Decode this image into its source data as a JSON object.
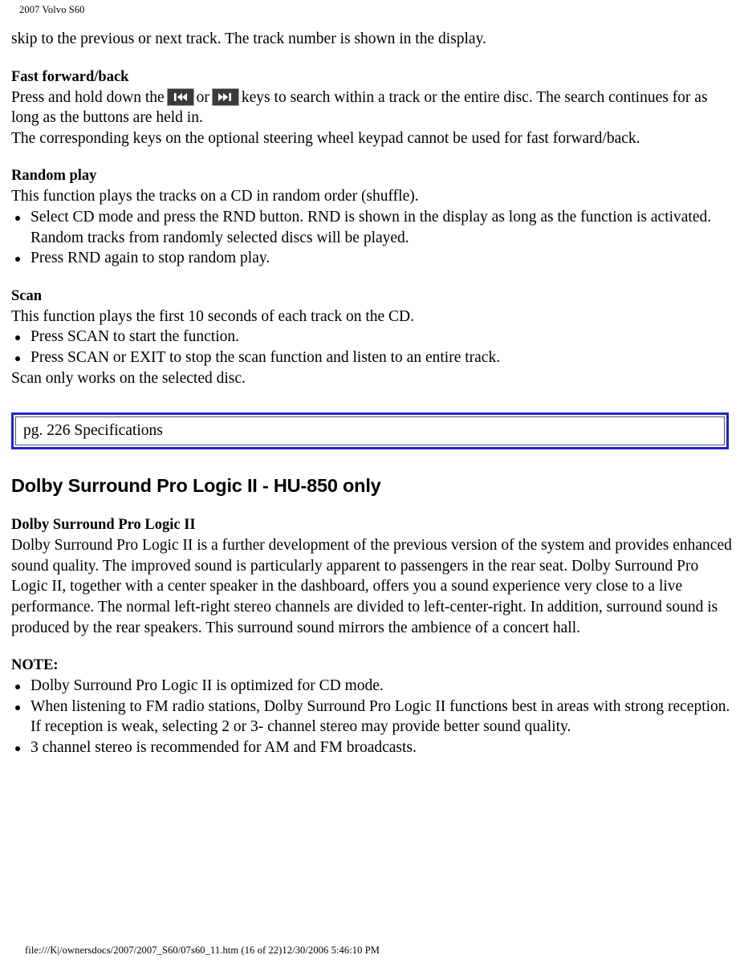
{
  "document": {
    "running_header": "2007 Volvo S60",
    "footer": "file:///K|/ownersdocs/2007/2007_S60/07s60_11.htm (16 of 22)12/30/2006 5:46:10 PM"
  },
  "colors": {
    "text": "#000000",
    "page_background": "#ffffff",
    "spec_box_border": "#2222cc",
    "spec_box_inner_border": "#555555",
    "key_icon_background": "#3a3a3a",
    "key_icon_glyph": "#ffffff"
  },
  "content": {
    "continued_paragraph": "skip to the previous or next track. The track number is shown in the display.",
    "fast_forward": {
      "heading": "Fast forward/back",
      "sentence_part_1": "Press and hold down the",
      "or_word": "or",
      "sentence_part_2": "keys to search within a track or the entire disc. The search continues for as long as the buttons are held in.",
      "sentence_3": "The corresponding keys on the optional steering wheel keypad cannot be used for fast forward/back.",
      "icon_rewind": "rewind-key-icon",
      "icon_fast_forward": "fast-forward-key-icon"
    },
    "random_play": {
      "heading": "Random play",
      "intro": "This function plays the tracks on a CD in random order (shuffle).",
      "bullets": [
        "Select CD mode and press the RND button. RND is shown in the display as long as the function is activated. Random tracks from randomly selected discs will be played.",
        "Press RND again to stop random play."
      ]
    },
    "scan": {
      "heading": "Scan",
      "intro": "This function plays the first 10 seconds of each track on the CD.",
      "bullets": [
        "Press SCAN to start the function.",
        "Press SCAN or EXIT to stop the scan function and listen to an entire track."
      ],
      "outro": "Scan only works on the selected disc."
    },
    "spec_box": {
      "label": "pg. 226 Specifications"
    },
    "dolby": {
      "section_title": "Dolby Surround Pro Logic II - HU-850 only",
      "heading": "Dolby Surround Pro Logic II",
      "paragraph": "Dolby Surround Pro Logic II is a further development of the previous version of the system and provides enhanced sound quality. The improved sound is particularly apparent to passengers in the rear seat. Dolby Surround Pro Logic II, together with a center speaker in the dashboard, offers you a sound experience very close to a live performance. The normal left-right stereo channels are divided to left-center-right. In addition, surround sound is produced by the rear speakers. This surround sound mirrors the ambience of a concert hall."
    },
    "note": {
      "heading": "NOTE:",
      "bullets": [
        "Dolby Surround Pro Logic II is optimized for CD mode.",
        "When listening to FM radio stations, Dolby Surround Pro Logic II functions best in areas with strong reception. If reception is weak, selecting 2 or 3- channel stereo may provide better sound quality.",
        "3 channel stereo is recommended for AM and FM broadcasts."
      ]
    }
  }
}
